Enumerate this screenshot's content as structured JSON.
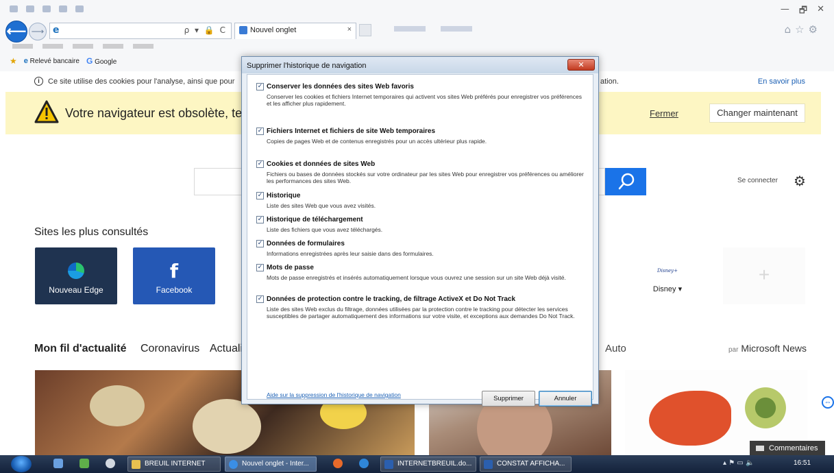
{
  "browser": {
    "tab_label": "Nouvel onglet",
    "tab_close": "×",
    "window_controls": [
      "—",
      "🗗",
      "✕"
    ],
    "address_tools": "ρ ▾ 🔒 C",
    "favorites": {
      "item1": "Relevé bancaire",
      "item2": "Google"
    }
  },
  "page": {
    "cookie_notice": "Ce site utilise des cookies pour l'analyse, ainsi que pour",
    "cookie_notice_tail": "ation.",
    "cookie_learn_more": "En savoir plus",
    "warning_text": "Votre navigateur est obsolète, te",
    "warning_close": "Fermer",
    "warning_update": "Changer maintenant",
    "signin": "Se connecter",
    "top_sites_title": "Sites les plus consultés",
    "tiles": [
      {
        "label": "Nouveau Edge"
      },
      {
        "label": "Facebook",
        "glyph": "f"
      },
      {
        "label": "Disney",
        "logo": "Disney+"
      }
    ],
    "add_tile_glyph": "+",
    "news": {
      "feed": "Mon fil d'actualité",
      "tab_corona": "Coronavirus",
      "tab_actu": "Actuali",
      "tab_auto": "Auto",
      "by_prefix": "par",
      "by_source": "Microsoft News"
    },
    "feedback": "Commentaires"
  },
  "dialog": {
    "title": "Supprimer l'historique de navigation",
    "close_glyph": "✕",
    "options": [
      {
        "checked": true,
        "title": "Conserver les données des sites Web favoris",
        "desc": "Conserver les cookies et fichiers Internet temporaires qui activent vos sites Web préférés pour enregistrer vos préférences et les afficher plus rapidement."
      },
      {
        "checked": true,
        "title": "Fichiers Internet et fichiers de site Web temporaires",
        "desc": "Copies de pages Web et de contenus enregistrés pour un accès ultérieur plus rapide."
      },
      {
        "checked": true,
        "title": "Cookies et données de sites Web",
        "desc": "Fichiers ou bases de données stockés sur votre ordinateur par les sites Web pour enregistrer vos préférences ou améliorer les performances des sites Web."
      },
      {
        "checked": true,
        "title": "Historique",
        "desc": "Liste des sites Web que vous avez visités."
      },
      {
        "checked": true,
        "title": "Historique de téléchargement",
        "desc": "Liste des fichiers que vous avez téléchargés."
      },
      {
        "checked": true,
        "title": "Données de formulaires",
        "desc": "Informations enregistrées après leur saisie dans des formulaires."
      },
      {
        "checked": true,
        "title": "Mots de passe",
        "desc": "Mots de passe enregistrés et insérés automatiquement lorsque vous ouvrez une session sur un site Web déjà visité."
      },
      {
        "checked": true,
        "title": "Données de protection contre le tracking, de filtrage ActiveX et Do Not Track",
        "desc": "Liste des sites Web exclus du filtrage, données utilisées par la protection contre le tracking pour détecter les services susceptibles de partager automatiquement des informations sur votre visite, et exceptions aux demandes Do Not Track."
      }
    ],
    "check_glyph": "✓",
    "help_link": "Aide sur la suppression de l'historique de navigation",
    "delete_button": "Supprimer",
    "cancel_button": "Annuler"
  },
  "taskbar": {
    "items": [
      {
        "label": "BREUIL INTERNET",
        "icon_color": "#e8c050"
      },
      {
        "label": "Nouvel onglet - Inter...",
        "icon_color": "#3a8ee6"
      },
      {
        "label": "INTERNETBREUIL.do...",
        "icon_color": "#2b5fae"
      },
      {
        "label": "CONSTAT AFFICHA...",
        "icon_color": "#2b5fae"
      }
    ],
    "tray_icons": "▴ ⚑ ▭ 🔈",
    "clock": "16:51"
  },
  "colors": {
    "ie_accent": "#1f6fd1",
    "warning_bg": "#fdf6c3",
    "search_button": "#1a73e8"
  }
}
